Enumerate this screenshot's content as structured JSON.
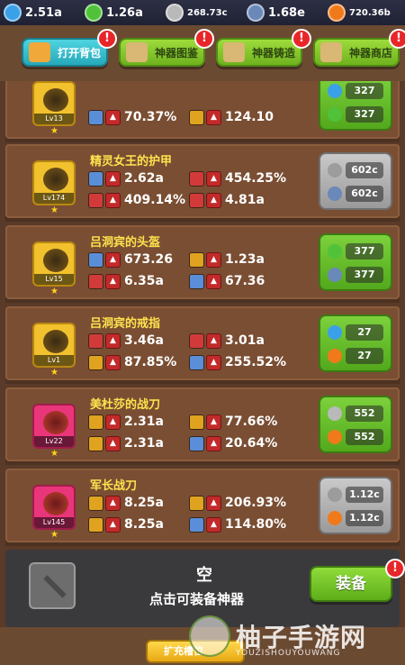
{
  "resources": [
    {
      "value": "2.51a",
      "icon": "blue-gem-icon",
      "color": "#3aa0e8",
      "small": false
    },
    {
      "value": "1.26a",
      "icon": "green-gem-icon",
      "color": "#4fc23a",
      "small": false
    },
    {
      "value": "268.73c",
      "icon": "silver-triangle-icon",
      "color": "#b9b9b9",
      "small": true
    },
    {
      "value": "1.68e",
      "icon": "blue-crystal-icon",
      "color": "#6a88b8",
      "small": false
    },
    {
      "value": "720.36b",
      "icon": "fire-orb-icon",
      "color": "#f07a1a",
      "small": true
    }
  ],
  "tabs": [
    {
      "label": "打开背包",
      "icon": "backpack-icon",
      "style": "teal",
      "alert": "!"
    },
    {
      "label": "神器图鉴",
      "icon": "book-icon",
      "style": "green",
      "alert": "!"
    },
    {
      "label": "神器铸造",
      "icon": "anvil-icon",
      "style": "green",
      "alert": "!"
    },
    {
      "label": "神器商店",
      "icon": "shop-ring-icon",
      "style": "green",
      "alert": "!"
    }
  ],
  "artifacts": [
    {
      "name": "",
      "level": "Lv13",
      "portrait": "gold",
      "stats": [
        {
          "icon": "shield-icon",
          "iconColor": "blue",
          "value": "70.37%"
        },
        {
          "icon": "sword-icon",
          "iconColor": "gold",
          "value": "124.10"
        }
      ],
      "req_style": "green",
      "reqs": [
        {
          "icon": "water-drop-icon",
          "color": "#3aa0e8",
          "value": "327"
        },
        {
          "icon": "green-gem-icon",
          "color": "#4fc23a",
          "value": "327"
        }
      ]
    },
    {
      "name": "精灵女王的护甲",
      "level": "Lv174",
      "portrait": "gold",
      "stats": [
        {
          "icon": "shield-icon",
          "iconColor": "blue",
          "value": "2.62a"
        },
        {
          "icon": "heart-icon",
          "iconColor": "red",
          "value": "454.25%"
        },
        {
          "icon": "heart-icon",
          "iconColor": "red",
          "value": "409.14%"
        },
        {
          "icon": "heart-icon",
          "iconColor": "red",
          "value": "4.81a"
        }
      ],
      "req_style": "gray",
      "reqs": [
        {
          "icon": "silver-triangle-icon",
          "color": "#9c9c9c",
          "value": "602c"
        },
        {
          "icon": "blue-crystal-icon",
          "color": "#6a88b8",
          "value": "602c"
        }
      ]
    },
    {
      "name": "吕洞宾的头盔",
      "level": "Lv15",
      "portrait": "gold",
      "stats": [
        {
          "icon": "shield-icon",
          "iconColor": "blue",
          "value": "673.26"
        },
        {
          "icon": "shield-icon",
          "iconColor": "gold",
          "value": "1.23a"
        },
        {
          "icon": "heart-icon",
          "iconColor": "red",
          "value": "6.35a"
        },
        {
          "icon": "shield-icon",
          "iconColor": "blue",
          "value": "67.36"
        }
      ],
      "req_style": "green",
      "reqs": [
        {
          "icon": "green-gem-icon",
          "color": "#4fc23a",
          "value": "377"
        },
        {
          "icon": "blue-crystal-icon",
          "color": "#6a88b8",
          "value": "377"
        }
      ]
    },
    {
      "name": "吕洞宾的戒指",
      "level": "Lv1",
      "portrait": "gold",
      "stats": [
        {
          "icon": "crossed-swords-icon",
          "iconColor": "red",
          "value": "3.46a"
        },
        {
          "icon": "crossed-swords-icon",
          "iconColor": "red",
          "value": "3.01a"
        },
        {
          "icon": "sword-icon",
          "iconColor": "gold",
          "value": "87.85%"
        },
        {
          "icon": "shield-icon",
          "iconColor": "blue",
          "value": "255.52%"
        }
      ],
      "req_style": "green",
      "reqs": [
        {
          "icon": "water-drop-icon",
          "color": "#3aa0e8",
          "value": "27"
        },
        {
          "icon": "fire-orb-icon",
          "color": "#f07a1a",
          "value": "27"
        }
      ]
    },
    {
      "name": "美杜莎的战刀",
      "level": "Lv22",
      "portrait": "pink",
      "stats": [
        {
          "icon": "sword-icon",
          "iconColor": "gold",
          "value": "2.31a"
        },
        {
          "icon": "sword-icon",
          "iconColor": "gold",
          "value": "77.66%"
        },
        {
          "icon": "sword-icon",
          "iconColor": "gold",
          "value": "2.31a"
        },
        {
          "icon": "hammer-icon",
          "iconColor": "blue",
          "value": "20.64%"
        }
      ],
      "req_style": "green",
      "reqs": [
        {
          "icon": "silver-triangle-icon",
          "color": "#b9b9b9",
          "value": "552"
        },
        {
          "icon": "fire-orb-icon",
          "color": "#f07a1a",
          "value": "552"
        }
      ]
    },
    {
      "name": "军长战刀",
      "level": "Lv145",
      "portrait": "pink",
      "stats": [
        {
          "icon": "sword-icon",
          "iconColor": "gold",
          "value": "8.25a"
        },
        {
          "icon": "sword-icon",
          "iconColor": "gold",
          "value": "206.93%"
        },
        {
          "icon": "sword-icon",
          "iconColor": "gold",
          "value": "8.25a"
        },
        {
          "icon": "hammer-icon",
          "iconColor": "blue",
          "value": "114.80%"
        }
      ],
      "req_style": "gray",
      "reqs": [
        {
          "icon": "silver-triangle-icon",
          "color": "#9c9c9c",
          "value": "1.12c"
        },
        {
          "icon": "fire-orb-icon",
          "color": "#f07a1a",
          "value": "1.12c"
        }
      ]
    }
  ],
  "empty_slot": {
    "title": "空",
    "hint": "点击可装备神器",
    "button": "装备",
    "alert": "!"
  },
  "bottom": {
    "expand_label": "扩充槽位"
  },
  "watermark": {
    "text": "柚子手游网",
    "sub": "YOUZISHOUYOUWANG"
  }
}
